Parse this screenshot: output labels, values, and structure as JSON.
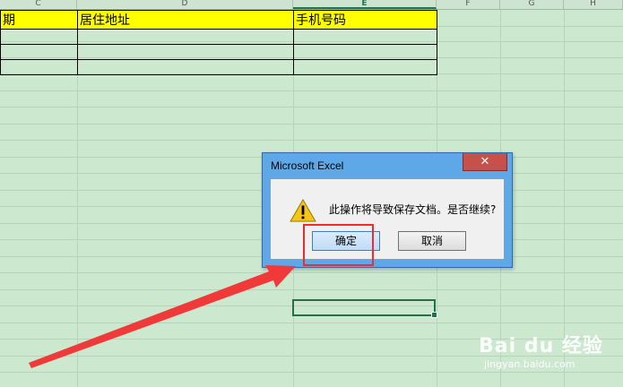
{
  "columns": [
    {
      "letter": "C"
    },
    {
      "letter": "D"
    },
    {
      "letter": "E"
    },
    {
      "letter": "F"
    },
    {
      "letter": "G"
    },
    {
      "letter": "H"
    }
  ],
  "table": {
    "headers": [
      "期",
      "居住地址",
      "手机号码"
    ],
    "rows": [
      [
        "",
        "",
        ""
      ],
      [
        "",
        "",
        ""
      ],
      [
        "",
        "",
        ""
      ]
    ]
  },
  "dialog": {
    "title": "Microsoft Excel",
    "close": "✕",
    "message": "此操作将导致保存文档。是否继续?",
    "ok_label": "确定",
    "cancel_label": "取消"
  },
  "watermark": {
    "logo": "Bai du 经验",
    "url": "jingyan.baidu.com"
  },
  "colors": {
    "header_fill": "#ffff00",
    "sheet_bg": "#cce8cf",
    "highlight": "#f02b2b",
    "selection": "#217346"
  }
}
